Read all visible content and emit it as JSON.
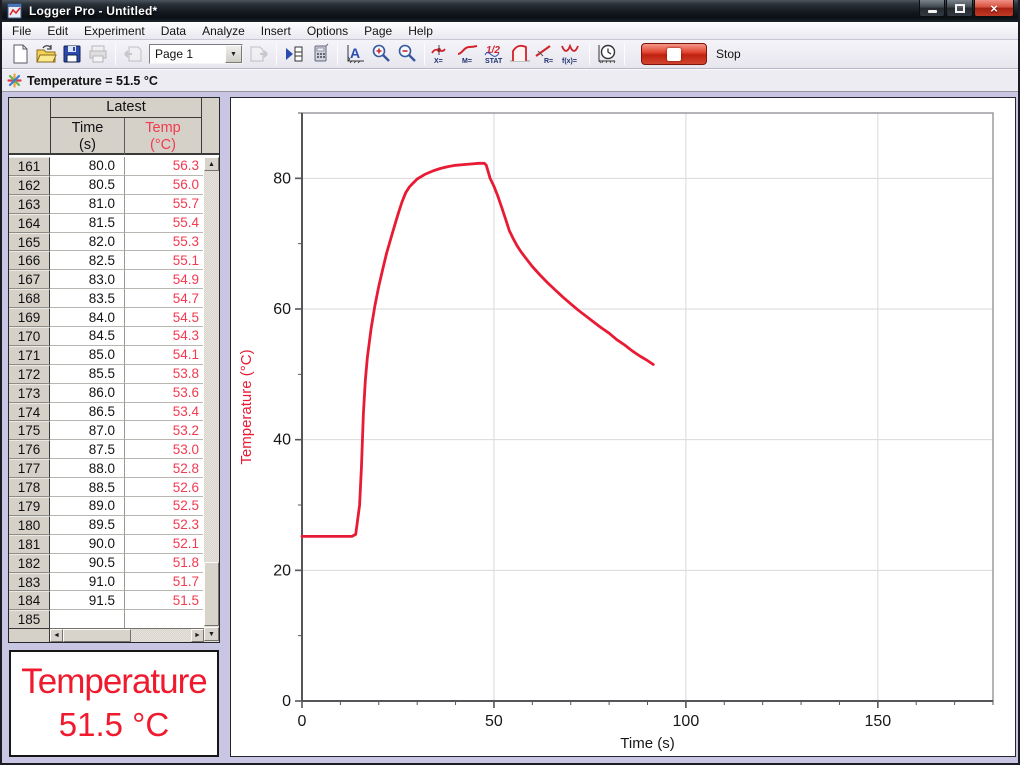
{
  "window": {
    "title": "Logger Pro - Untitled*"
  },
  "menu": {
    "items": [
      "File",
      "Edit",
      "Experiment",
      "Data",
      "Analyze",
      "Insert",
      "Options",
      "Page",
      "Help"
    ]
  },
  "toolbar": {
    "page_selector_value": "Page 1",
    "stop_label": "Stop",
    "icons": [
      "new-file",
      "open-file",
      "save",
      "print",
      "previous-page",
      "page-selector",
      "next-page",
      "data-browser",
      "calculator",
      "autoscale",
      "zoom-in",
      "zoom-out",
      "examine",
      "tangent",
      "statistics",
      "integral",
      "linear-fit",
      "curve-fit",
      "data-collection-setup",
      "stop"
    ],
    "icon_glyphs": {
      "autoscale": "A",
      "examine": "X=",
      "tangent": "M=",
      "statistics_top": "1/2",
      "statistics": "STAT",
      "linear_fit": "R=",
      "curve_fit": "f(x)="
    }
  },
  "readout": {
    "text": "Temperature =  51.5 °C"
  },
  "table": {
    "group_header": "Latest",
    "col1_line1": "Time",
    "col1_line2": "(s)",
    "col2_line1": "Temp",
    "col2_line2": "(°C)",
    "rows": [
      [
        "161",
        "80.0",
        "56.3"
      ],
      [
        "162",
        "80.5",
        "56.0"
      ],
      [
        "163",
        "81.0",
        "55.7"
      ],
      [
        "164",
        "81.5",
        "55.4"
      ],
      [
        "165",
        "82.0",
        "55.3"
      ],
      [
        "166",
        "82.5",
        "55.1"
      ],
      [
        "167",
        "83.0",
        "54.9"
      ],
      [
        "168",
        "83.5",
        "54.7"
      ],
      [
        "169",
        "84.0",
        "54.5"
      ],
      [
        "170",
        "84.5",
        "54.3"
      ],
      [
        "171",
        "85.0",
        "54.1"
      ],
      [
        "172",
        "85.5",
        "53.8"
      ],
      [
        "173",
        "86.0",
        "53.6"
      ],
      [
        "174",
        "86.5",
        "53.4"
      ],
      [
        "175",
        "87.0",
        "53.2"
      ],
      [
        "176",
        "87.5",
        "53.0"
      ],
      [
        "177",
        "88.0",
        "52.8"
      ],
      [
        "178",
        "88.5",
        "52.6"
      ],
      [
        "179",
        "89.0",
        "52.5"
      ],
      [
        "180",
        "89.5",
        "52.3"
      ],
      [
        "181",
        "90.0",
        "52.1"
      ],
      [
        "182",
        "90.5",
        "51.8"
      ],
      [
        "183",
        "91.0",
        "51.7"
      ],
      [
        "184",
        "91.5",
        "51.5"
      ],
      [
        "185",
        "",
        ""
      ]
    ]
  },
  "meter": {
    "label": "Temperature",
    "value": "51.5 °C"
  },
  "chart_data": {
    "type": "line",
    "title": "",
    "xlabel": "Time (s)",
    "ylabel": "Temperature (°C)",
    "xlim": [
      0,
      180
    ],
    "ylim": [
      0,
      90
    ],
    "xticks": [
      0,
      50,
      100,
      150
    ],
    "yticks": [
      0,
      20,
      40,
      60,
      80
    ],
    "minor_x_step": 10,
    "minor_y_step": 10,
    "grid": true,
    "legend_position": "none",
    "series": [
      {
        "name": "Temperature",
        "color": "#e81b35",
        "points": [
          [
            0,
            25.2
          ],
          [
            5,
            25.2
          ],
          [
            10,
            25.2
          ],
          [
            13,
            25.2
          ],
          [
            14,
            25.5
          ],
          [
            15,
            30
          ],
          [
            15.5,
            36
          ],
          [
            16,
            44
          ],
          [
            16.5,
            49
          ],
          [
            17,
            52.5
          ],
          [
            18,
            57
          ],
          [
            19,
            60.5
          ],
          [
            20,
            63.5
          ],
          [
            21,
            66
          ],
          [
            22,
            68.5
          ],
          [
            23,
            70.5
          ],
          [
            24,
            72.5
          ],
          [
            25,
            74.5
          ],
          [
            26,
            76.3
          ],
          [
            27,
            77.8
          ],
          [
            28,
            78.7
          ],
          [
            29,
            79.3
          ],
          [
            30,
            79.9
          ],
          [
            32,
            80.6
          ],
          [
            34,
            81.1
          ],
          [
            36,
            81.5
          ],
          [
            38,
            81.8
          ],
          [
            40,
            82.0
          ],
          [
            42,
            82.1
          ],
          [
            44,
            82.2
          ],
          [
            46,
            82.3
          ],
          [
            47.5,
            82.3
          ],
          [
            48,
            82.0
          ],
          [
            48.5,
            81.0
          ],
          [
            49,
            80.0
          ],
          [
            50,
            78.8
          ],
          [
            51,
            77.3
          ],
          [
            52,
            75.6
          ],
          [
            53,
            73.8
          ],
          [
            54,
            72.0
          ],
          [
            55,
            70.8
          ],
          [
            56,
            69.7
          ],
          [
            57,
            68.8
          ],
          [
            58,
            68.0
          ],
          [
            60,
            66.5
          ],
          [
            62,
            65.2
          ],
          [
            64,
            64.0
          ],
          [
            66,
            62.9
          ],
          [
            68,
            61.8
          ],
          [
            70,
            60.8
          ],
          [
            72,
            59.8
          ],
          [
            74,
            58.9
          ],
          [
            76,
            58.0
          ],
          [
            78,
            57.1
          ],
          [
            80,
            56.3
          ],
          [
            82,
            55.3
          ],
          [
            84,
            54.5
          ],
          [
            86,
            53.6
          ],
          [
            88,
            52.8
          ],
          [
            90,
            52.1
          ],
          [
            91.5,
            51.5
          ]
        ]
      }
    ]
  },
  "colors": {
    "accent_red": "#e81b35",
    "temp_text": "#f23a50",
    "lavender": "#c9c6e4",
    "grid": "#d9d9de",
    "axis": "#55565a",
    "header_gray": "#d5d1c9"
  }
}
